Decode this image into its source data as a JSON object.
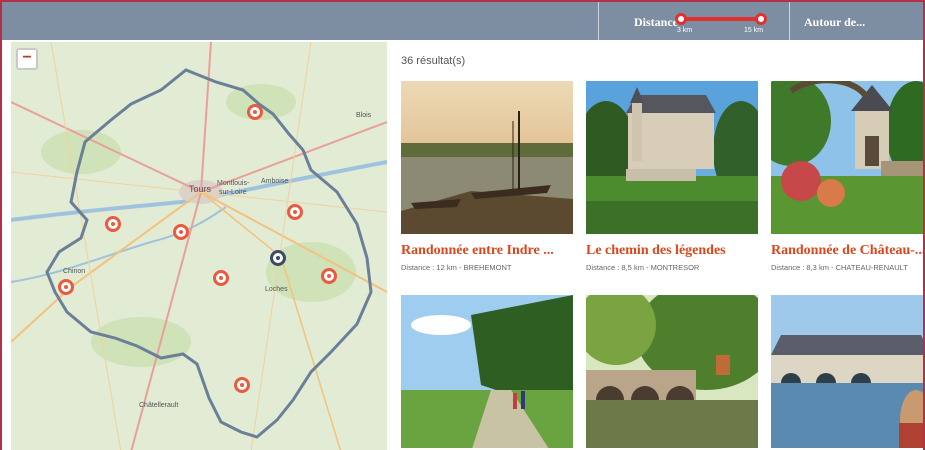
{
  "filters": {
    "distance_label": "Distance",
    "distance_min": "3 km",
    "distance_max": "15 km",
    "around_label": "Autour de..."
  },
  "map": {
    "zoom_out_label": "−",
    "places": {
      "blois": "Blois",
      "tours": "Tours",
      "montlouis": "Montlouis-",
      "montlouis2": "sur-Loire",
      "amboise": "Amboise",
      "chinon": "Chinon",
      "loches": "Loches",
      "chatellerault": "Châtellerault"
    }
  },
  "results": {
    "count_text": "36 résultat(s)",
    "cards": [
      {
        "title": "Randonnée entre Indre ...",
        "meta": "Distance : 12 km - BREHEMONT"
      },
      {
        "title": "Le chemin des légendes",
        "meta": "Distance : 8,5 km - MONTRESOR"
      },
      {
        "title": "Randonnée de Château-...",
        "meta": "Distance : 8,3 km - CHATEAU-RENAULT"
      },
      {
        "title": "",
        "meta": ""
      },
      {
        "title": "",
        "meta": ""
      },
      {
        "title": "",
        "meta": ""
      }
    ]
  },
  "colors": {
    "topbar": "#7d8ea3",
    "accent_red": "#e1312e",
    "title_orange": "#d9481d",
    "frame": "#b4304a",
    "pin": "#e95b3f",
    "pin_dark": "#3b4a66"
  }
}
